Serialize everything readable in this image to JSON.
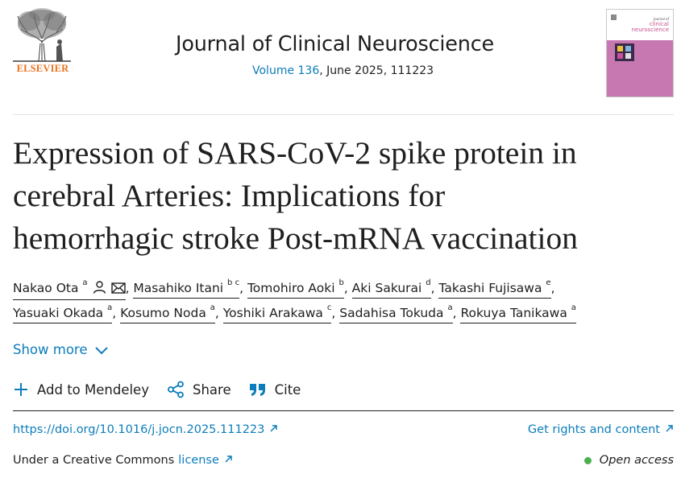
{
  "publisher": {
    "name": "ELSEVIER"
  },
  "journal": {
    "title": "Journal of Clinical Neuroscience",
    "volume_link": "Volume 136",
    "issue_info": ", June 2025, 111223",
    "cover_brand_small": "Journal of",
    "cover_brand_line1": "clinical",
    "cover_brand_line2": "neuroscience"
  },
  "article": {
    "title_line1": "Expression of SARS-CoV-2 spike protein in",
    "title_line2": "cerebral Arteries: Implications for",
    "title_line3": "hemorrhagic stroke Post-mRNA vaccination"
  },
  "authors": [
    {
      "name": "Nakao Ota",
      "aff": "a"
    },
    {
      "name": "Masahiko Itani",
      "aff": "b c"
    },
    {
      "name": "Tomohiro Aoki",
      "aff": "b"
    },
    {
      "name": "Aki Sakurai",
      "aff": "d"
    },
    {
      "name": "Takashi Fujisawa",
      "aff": "e"
    },
    {
      "name": "Yasuaki Okada",
      "aff": "a"
    },
    {
      "name": "Kosumo Noda",
      "aff": "a"
    },
    {
      "name": "Yoshiki Arakawa",
      "aff": "c"
    },
    {
      "name": "Sadahisa Tokuda",
      "aff": "a"
    },
    {
      "name": "Rokuya Tanikawa",
      "aff": "a"
    }
  ],
  "show_more_label": "Show more",
  "actions": {
    "mendeley": "Add to Mendeley",
    "share": "Share",
    "cite": "Cite"
  },
  "links": {
    "doi": "https://doi.org/10.1016/j.jocn.2025.111223",
    "rights": "Get rights and content"
  },
  "license": {
    "prefix": "Under a Creative Commons",
    "link": "license"
  },
  "access": {
    "label": "Open access",
    "dot_color": "#4caf50"
  },
  "colors": {
    "link": "#0c7dbb",
    "brand": "#e9711c"
  },
  "icons": [
    "elsevier-tree-logo",
    "person-icon",
    "envelope-icon",
    "chevron-down-icon",
    "plus-icon",
    "share-icon",
    "quote-icon",
    "arrow-up-right-icon"
  ]
}
